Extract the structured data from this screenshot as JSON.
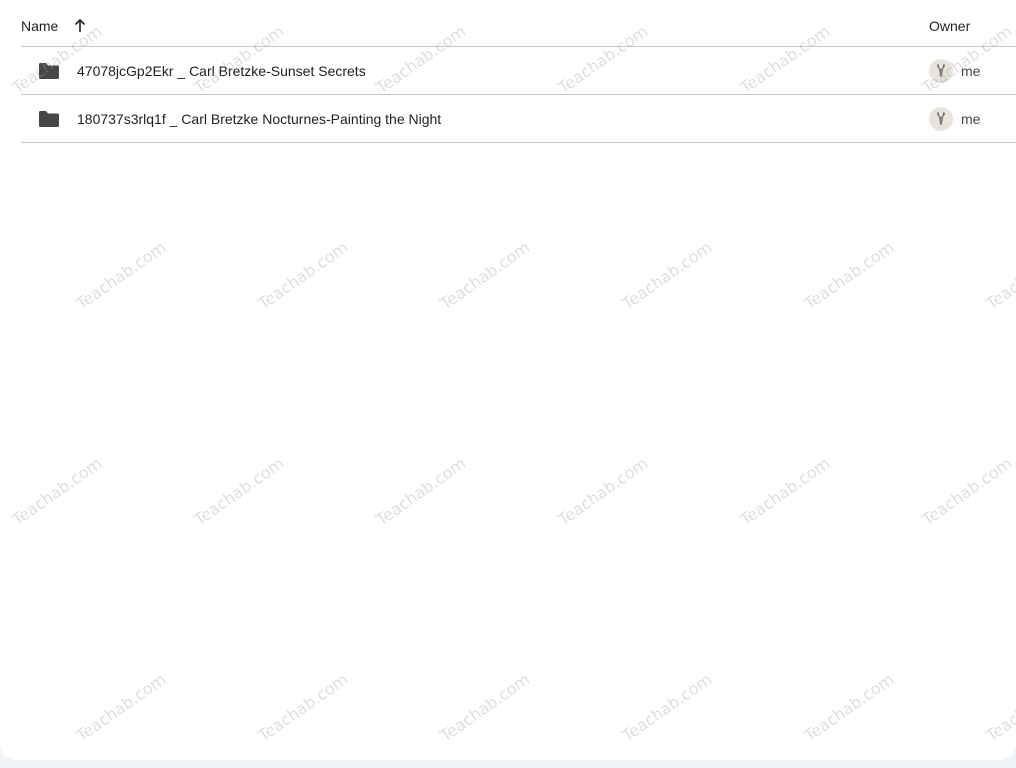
{
  "header": {
    "name_label": "Name",
    "owner_label": "Owner",
    "sort_icon": "arrow-upward-icon"
  },
  "rows": [
    {
      "name": "47078jcGp2Ekr _ Carl Bretzke-Sunset Secrets",
      "icon": "folder-icon",
      "owner": "me"
    },
    {
      "name": "180737s3rlq1f _ Carl Bretzke Nocturnes-Painting the Night",
      "icon": "folder-icon",
      "owner": "me"
    }
  ],
  "watermark": "Teachab.com",
  "colors": {
    "background": "#f0f4f9",
    "panel": "#ffffff",
    "divider": "#c7c7c7",
    "folder": "#444746"
  }
}
